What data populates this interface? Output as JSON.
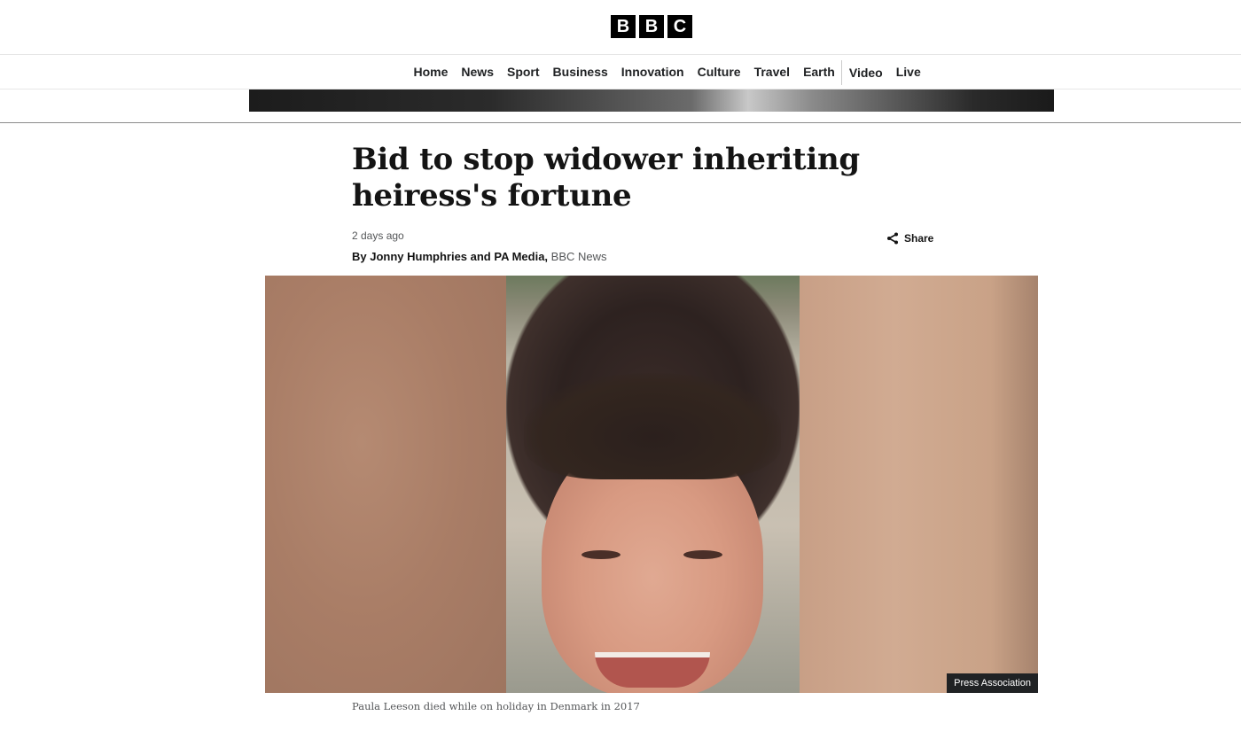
{
  "header": {
    "logo_letters": [
      "B",
      "B",
      "C"
    ]
  },
  "nav": {
    "items": [
      {
        "label": "Home"
      },
      {
        "label": "News"
      },
      {
        "label": "Sport"
      },
      {
        "label": "Business"
      },
      {
        "label": "Innovation"
      },
      {
        "label": "Culture"
      },
      {
        "label": "Travel"
      },
      {
        "label": "Earth"
      },
      {
        "label": "Video"
      },
      {
        "label": "Live"
      }
    ]
  },
  "article": {
    "headline": "Bid to stop widower inheriting heiress's fortune",
    "timestamp": "2 days ago",
    "byline_author": "By Jonny Humphries and PA Media,",
    "byline_org": "BBC News",
    "share_label": "Share",
    "image_credit": "Press Association",
    "image_caption": "Paula Leeson died while on holiday in Denmark in 2017"
  },
  "icons": {
    "share": "share-icon"
  },
  "colors": {
    "text": "#141414",
    "muted": "#545658",
    "logo_bg": "#000000",
    "credit_bg": "#202224"
  }
}
